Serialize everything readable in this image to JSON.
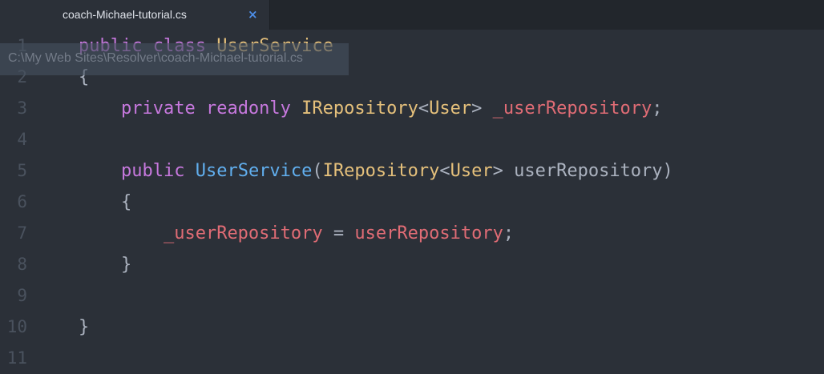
{
  "tab": {
    "filename": "coach-Michael-tutorial.cs",
    "close_glyph": "×",
    "close_icon": "close-icon"
  },
  "tooltip": {
    "path": "C:\\My Web Sites\\Resolver\\coach-Michael-tutorial.cs"
  },
  "colors": {
    "background": "#2b3038",
    "keyword": "#c678dd",
    "type": "#e5c07b",
    "function": "#61afef",
    "field": "#e06c75",
    "text": "#abb2bf",
    "tab_close": "#4d8ee8"
  },
  "lines": [
    {
      "number": "1",
      "tokens": [
        {
          "t": "public",
          "c": "kw"
        },
        {
          "t": " ",
          "c": "punct"
        },
        {
          "t": "class",
          "c": "kw"
        },
        {
          "t": " ",
          "c": "punct"
        },
        {
          "t": "UserService",
          "c": "type"
        }
      ]
    },
    {
      "number": "2",
      "tokens": [
        {
          "t": "{",
          "c": "punct"
        }
      ]
    },
    {
      "number": "3",
      "tokens": [
        {
          "t": "    ",
          "c": "punct"
        },
        {
          "t": "private",
          "c": "kw"
        },
        {
          "t": " ",
          "c": "punct"
        },
        {
          "t": "readonly",
          "c": "kw"
        },
        {
          "t": " ",
          "c": "punct"
        },
        {
          "t": "IRepository",
          "c": "type"
        },
        {
          "t": "<",
          "c": "punct"
        },
        {
          "t": "User",
          "c": "type"
        },
        {
          "t": "> ",
          "c": "punct"
        },
        {
          "t": "_userRepository",
          "c": "field"
        },
        {
          "t": ";",
          "c": "punct"
        }
      ]
    },
    {
      "number": "4",
      "tokens": []
    },
    {
      "number": "5",
      "tokens": [
        {
          "t": "    ",
          "c": "punct"
        },
        {
          "t": "public",
          "c": "kw"
        },
        {
          "t": " ",
          "c": "punct"
        },
        {
          "t": "UserService",
          "c": "fn"
        },
        {
          "t": "(",
          "c": "punct"
        },
        {
          "t": "IRepository",
          "c": "type"
        },
        {
          "t": "<",
          "c": "punct"
        },
        {
          "t": "User",
          "c": "type"
        },
        {
          "t": "> ",
          "c": "punct"
        },
        {
          "t": "userRepository",
          "c": "param"
        },
        {
          "t": ")",
          "c": "punct"
        }
      ]
    },
    {
      "number": "6",
      "tokens": [
        {
          "t": "    {",
          "c": "punct"
        }
      ]
    },
    {
      "number": "7",
      "tokens": [
        {
          "t": "        ",
          "c": "punct"
        },
        {
          "t": "_userRepository",
          "c": "field"
        },
        {
          "t": " = ",
          "c": "punct"
        },
        {
          "t": "userRepository",
          "c": "field"
        },
        {
          "t": ";",
          "c": "punct"
        }
      ]
    },
    {
      "number": "8",
      "tokens": [
        {
          "t": "    }",
          "c": "punct"
        }
      ]
    },
    {
      "number": "9",
      "tokens": []
    },
    {
      "number": "10",
      "tokens": [
        {
          "t": "}",
          "c": "punct"
        }
      ]
    },
    {
      "number": "11",
      "tokens": []
    }
  ]
}
